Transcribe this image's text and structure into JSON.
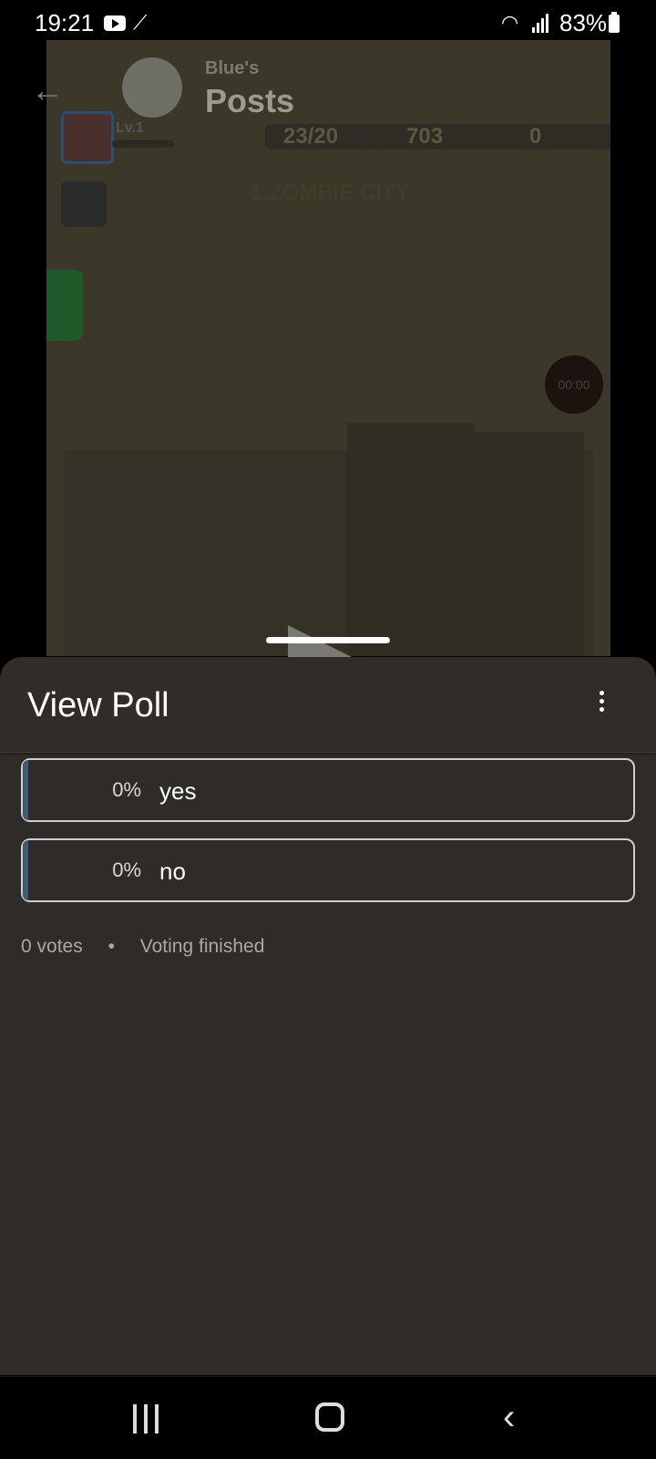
{
  "status_bar": {
    "time": "19:21",
    "battery": "83%",
    "icons": [
      "youtube-icon",
      "magic-wand-icon",
      "wifi-icon",
      "signal-icon",
      "battery-icon"
    ]
  },
  "background_post": {
    "subtitle": "Blue's",
    "title": "Posts",
    "game_hud": {
      "level": "Lv.1",
      "energy": "23/20",
      "coins": "703",
      "gems": "0",
      "zone": "1.ZOMBIE CITY",
      "timer": "00:00"
    }
  },
  "poll_sheet": {
    "title": "View Poll",
    "options": [
      {
        "percent": "0%",
        "label": "yes"
      },
      {
        "percent": "0%",
        "label": "no"
      }
    ],
    "votes": "0 votes",
    "separator": "•",
    "status": "Voting finished"
  },
  "colors": {
    "sheet_bg": "#2e2b29",
    "option_border": "#cfcfcf",
    "option_fill": "#3f5c6e"
  }
}
